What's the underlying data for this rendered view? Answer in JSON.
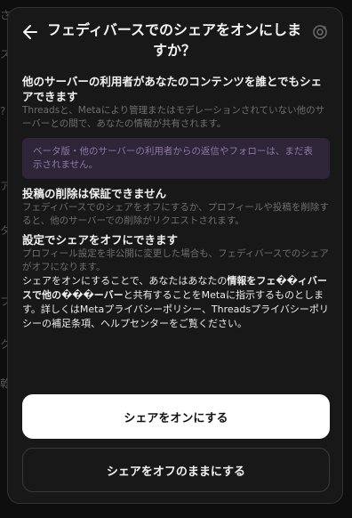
{
  "background": {
    "strip_glyphs": [
      "さ",
      "ス",
      "?",
      "ア",
      "タ",
      "フ",
      "ク",
      "乾"
    ]
  },
  "dialog": {
    "title": "フェディバースでのシェアをオンにしますか？",
    "back_icon": "arrow-left-icon",
    "header_icon": "fediverse-icon",
    "sections": {
      "share_title": "他のサーバーの利用者があなたのコンテンツを誰とでもシェアできます",
      "share_body": "Threadsと、Metaにより管理またはモデレーションされていない他のサーバーとの間で、あなたの情報が共有されます。",
      "notice": "ベータ版・他のサーバーの利用者からの返信やフォローは、まだ表示されません。",
      "delete_title": "投稿の削除は保証できません",
      "delete_body": "フェディバースでのシェアをオフにするか、プロフィールや投稿を削除すると、他のサーバーでの削除がリクエストされます。",
      "settings_title": "設定でシェアをオフにできます",
      "settings_body": "プロフィール設定を非公開に変更した場合も、フェディバースでのシェアがオフになります。"
    },
    "consent": {
      "prefix": "シェアをオンにすることで、あなたはあなたの",
      "bold": "情報をフェ��ィバースで他の���ーバー",
      "suffix": "と共有することをMetaに指示するものとします。詳しくはMetaプライバシーポリシー、Threadsプライバシーポリシーの補足条項、ヘルプセンターをご覧ください。"
    },
    "buttons": {
      "turn_on": "シェアをオンにする",
      "keep_off": "シェアをオフのままにする"
    }
  },
  "colors": {
    "dialog_bg": "#181818",
    "notice_bg": "#2e2538",
    "primary_button": "#ffffff"
  }
}
